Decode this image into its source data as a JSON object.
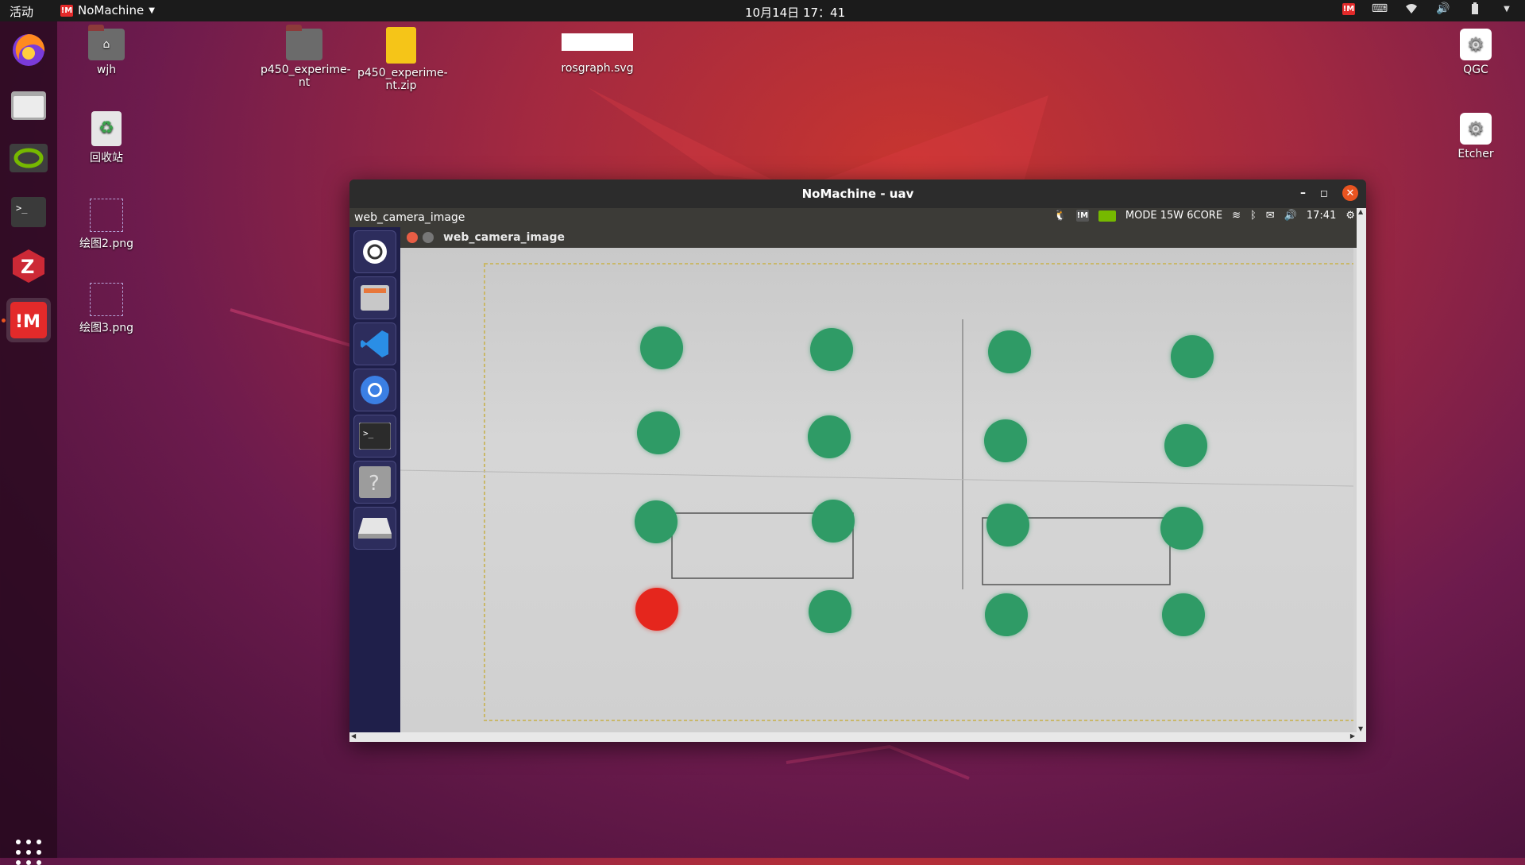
{
  "topbar": {
    "activities": "活动",
    "app_menu": "NoMachine",
    "clock": "10月14日  17：41"
  },
  "desktop": {
    "icons": [
      {
        "label": "wjh"
      },
      {
        "label": "p450_experime-nt"
      },
      {
        "label": "p450_experime-nt.zip"
      },
      {
        "label": "rosgraph.svg"
      },
      {
        "label": "回收站"
      },
      {
        "label": "绘图2.png"
      },
      {
        "label": "绘图3.png"
      },
      {
        "label": "QGC"
      },
      {
        "label": "Etcher"
      }
    ]
  },
  "nomachine": {
    "window_title": "NoMachine - uav",
    "remote_panel_title": "web_camera_image",
    "remote_tray_mode": "MODE 15W 6CORE",
    "remote_tray_time": "17:41",
    "image_window_title": "web_camera_image"
  },
  "colors": {
    "green_marker": "#2f9b66",
    "red_marker": "#e5261d",
    "accent": "#e95420"
  }
}
